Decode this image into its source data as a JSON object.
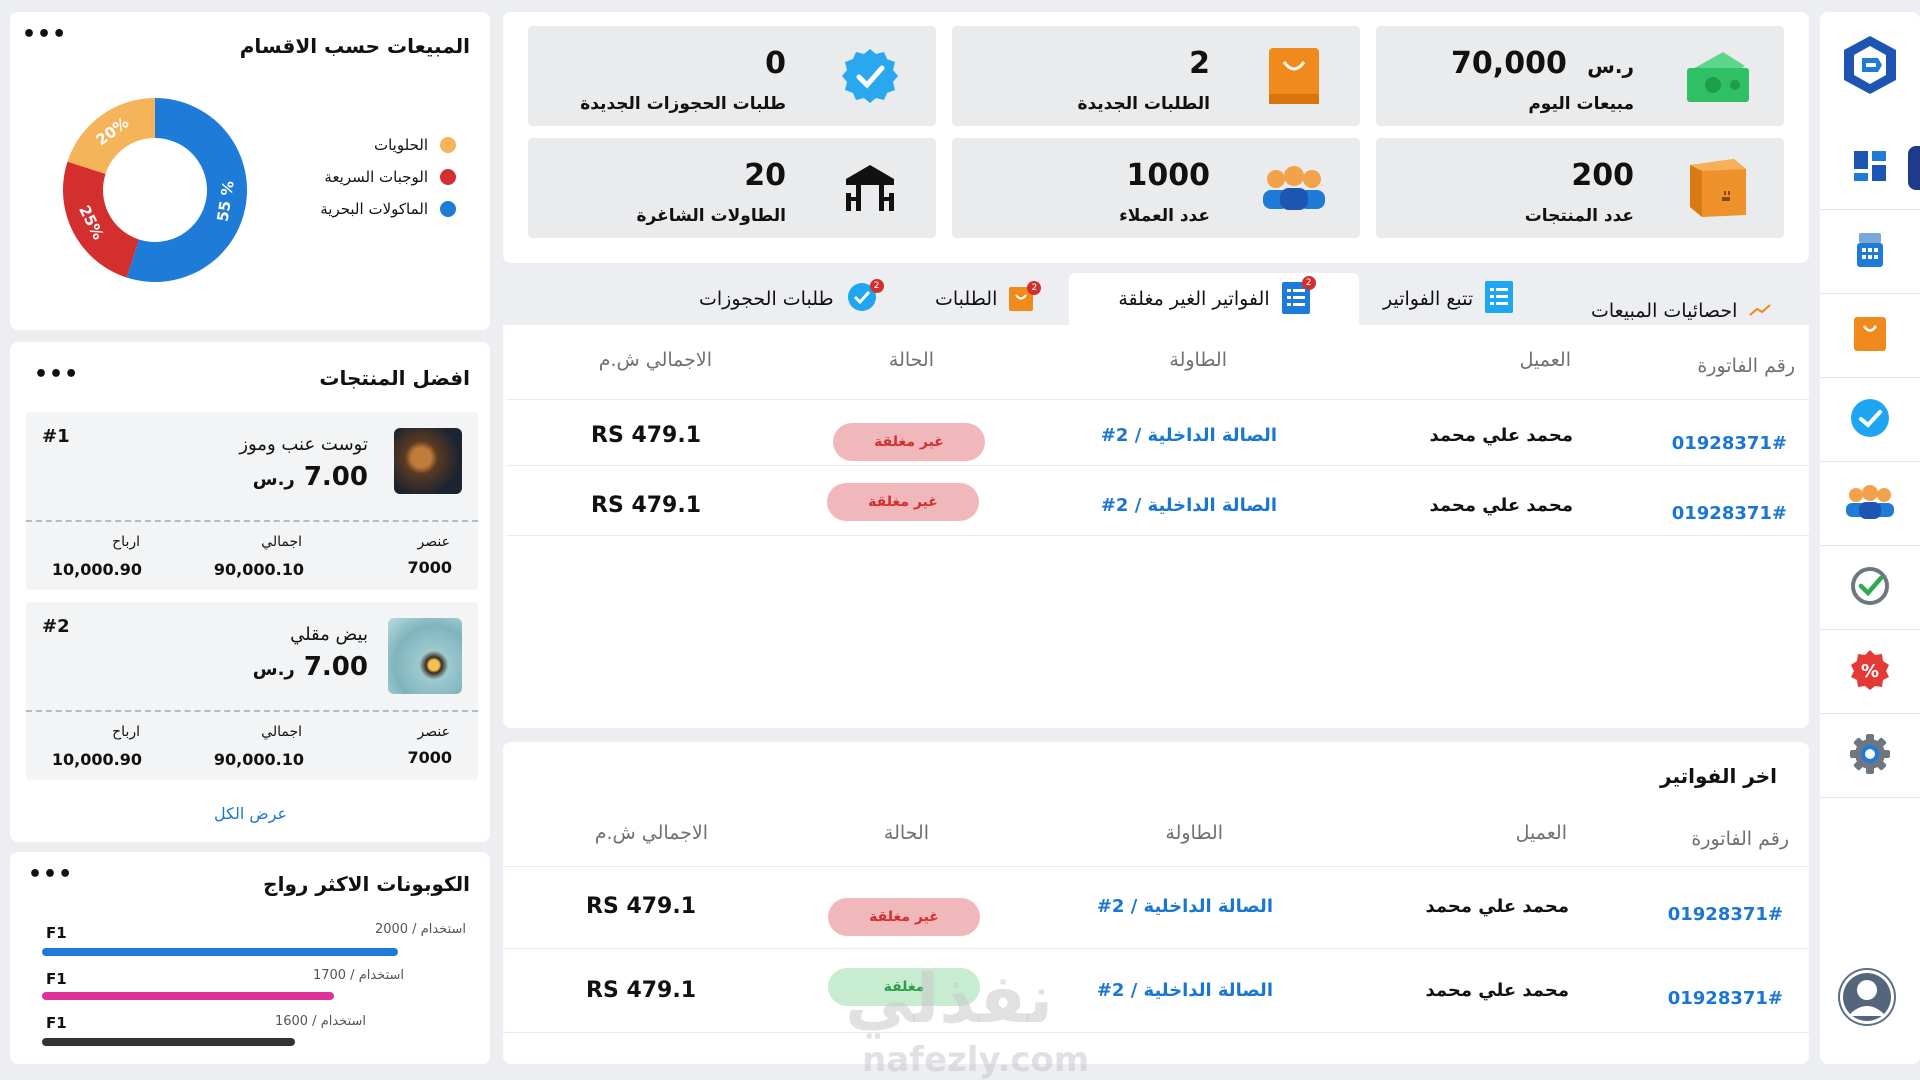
{
  "stats": [
    {
      "value": "70,000",
      "unit": "ر.س",
      "label": "مبيعات اليوم",
      "icon": "money-icon"
    },
    {
      "value": "2",
      "label": "الطلبات الجديدة",
      "icon": "shopping-bag-icon"
    },
    {
      "value": "0",
      "label": "طلبات الحجوزات الجديدة",
      "icon": "verified-check-icon"
    },
    {
      "value": "200",
      "label": "عدد المنتجات",
      "icon": "box-icon"
    },
    {
      "value": "1000",
      "label": "عدد العملاء",
      "icon": "customers-icon"
    },
    {
      "value": "20",
      "label": "الطاولات الشاغرة",
      "icon": "table-icon"
    }
  ],
  "tabs": [
    {
      "label": "احصائيات المبيعات",
      "icon": "trend-icon"
    },
    {
      "label": "تتبع الفواتير",
      "icon": "receipt-icon"
    },
    {
      "label": "الفواتير الغير مغلقة",
      "icon": "invoice-icon",
      "badge": "2"
    },
    {
      "label": "الطلبات",
      "icon": "order-icon",
      "badge": "2"
    },
    {
      "label": "طلبات الحجوزات",
      "icon": "reservation-icon",
      "badge": "2"
    }
  ],
  "table_headers": {
    "invoice": "رقم الفاتورة",
    "customer": "العميل",
    "table": "الطاولة",
    "status": "الحالة",
    "total": "الاجمالي ش.م"
  },
  "open_invoices": [
    {
      "invoice": "01928371#",
      "customer": "محمد علي محمد",
      "table": "الصالة الداخلية / 2#",
      "status": "غير مغلقة",
      "total": "RS 479.1"
    },
    {
      "invoice": "01928371#",
      "customer": "محمد علي محمد",
      "table": "الصالة الداخلية / 2#",
      "status": "غير مغلقة",
      "total": "RS 479.1"
    }
  ],
  "latest_invoices": {
    "title": "اخر الفواتير",
    "rows": [
      {
        "invoice": "01928371#",
        "customer": "محمد علي محمد",
        "table": "الصالة الداخلية / 2#",
        "status": "غير مغلقة",
        "total": "RS 479.1"
      },
      {
        "invoice": "01928371#",
        "customer": "محمد علي محمد",
        "table": "الصالة الداخلية / 2#",
        "status": "مغلقة",
        "total": "RS 479.1"
      }
    ]
  },
  "sales_by_category": {
    "title": "المبيعات حسب الاقسام",
    "legend": [
      "الحلويات",
      "الوجبات السريعة",
      "الماكولات البحرية"
    ],
    "colors": [
      "#f6b45a",
      "#d32f2f",
      "#1e7bd8"
    ]
  },
  "chart_data": {
    "type": "pie",
    "title": "المبيعات حسب الاقسام",
    "categories": [
      "الحلويات",
      "الوجبات السريعة",
      "الماكولات البحرية"
    ],
    "values": [
      20,
      25,
      55
    ],
    "labels": [
      "20%",
      "25%",
      "55 %"
    ],
    "legend_position": "right"
  },
  "top_products": {
    "title": "افضل المنتجات",
    "view_all": "عرض الكل",
    "metric_labels": {
      "item": "عنصر",
      "total": "اجمالي",
      "profit": "ارباح"
    },
    "items": [
      {
        "rank": "#1",
        "name": "توست عنب وموز",
        "price": "7.00",
        "currency": "ر.س",
        "item": "7000",
        "total": "90,000.10",
        "profit": "10,000.90"
      },
      {
        "rank": "#2",
        "name": "بيض مقلي",
        "price": "7.00",
        "currency": "ر.س",
        "item": "7000",
        "total": "90,000.10",
        "profit": "10,000.90"
      }
    ]
  },
  "coupons": {
    "title": "الكوبونات الاكثر رواج",
    "items": [
      {
        "code": "F1",
        "uses": "2000",
        "use_label": "استخدام",
        "color": "#1e7bd8",
        "fraction": 1.0
      },
      {
        "code": "F1",
        "uses": "1700",
        "use_label": "استخدام",
        "color": "#e0309a",
        "fraction": 0.82
      },
      {
        "code": "F1",
        "uses": "1600",
        "use_label": "استخدام",
        "color": "#333333",
        "fraction": 0.71
      }
    ]
  },
  "more_menu": "•••",
  "sidebar": [
    "logo-icon",
    "dashboard-icon",
    "cash-register-icon",
    "shopping-bag-icon",
    "verified-check-icon",
    "customers-icon",
    "approve-icon",
    "discount-icon",
    "settings-icon",
    "user-avatar-icon"
  ],
  "watermark": {
    "arabic": "نفذلي",
    "latin": "nafezly.com"
  }
}
